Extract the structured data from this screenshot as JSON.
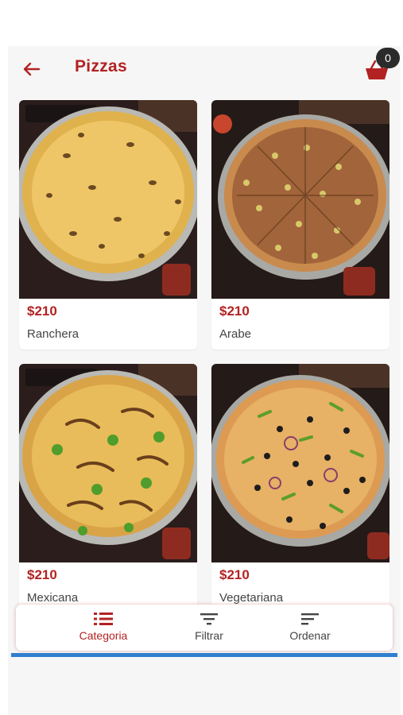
{
  "header": {
    "title": "Pizzas",
    "cart_count": "0"
  },
  "products": [
    {
      "price": "$210",
      "name": "Ranchera"
    },
    {
      "price": "$210",
      "name": "Arabe"
    },
    {
      "price": "$210",
      "name": "Mexicana"
    },
    {
      "price": "$210",
      "name": "Vegetariana"
    }
  ],
  "bottom_bar": {
    "categoria": "Categoria",
    "filtrar": "Filtrar",
    "ordenar": "Ordenar",
    "active": "Categoria"
  },
  "colors": {
    "accent": "#b32222",
    "badge": "#2b2b2b",
    "progress": "#2f7fd0"
  },
  "icons": [
    "back-arrow-icon",
    "cart-icon",
    "list-icon",
    "filter-icon",
    "sort-icon"
  ]
}
